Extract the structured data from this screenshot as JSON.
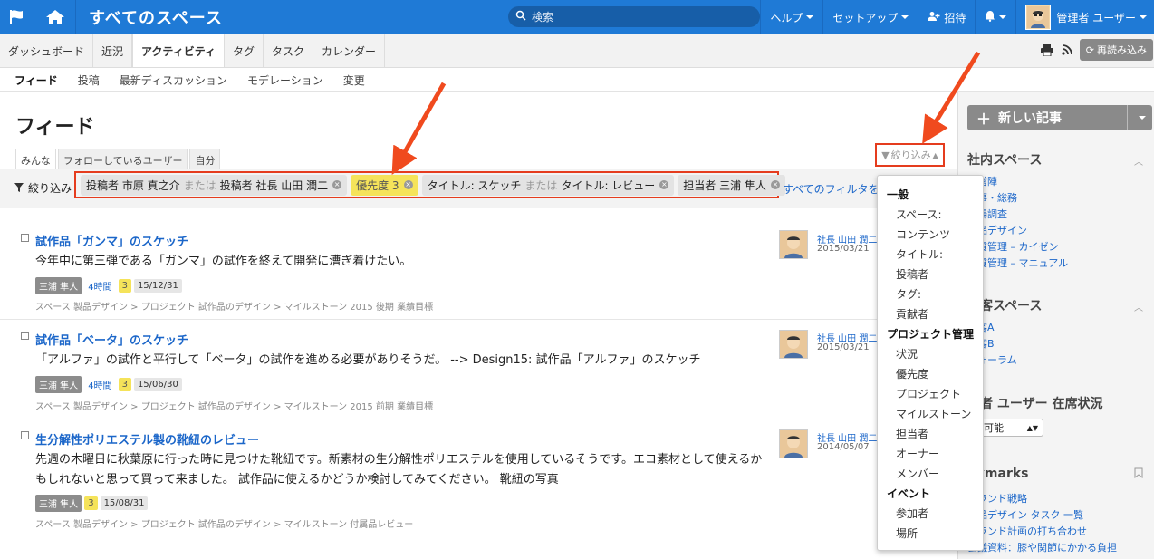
{
  "topbar": {
    "title": "すべてのスペース",
    "search_placeholder": "検索",
    "help": "ヘルプ",
    "setup": "セットアップ",
    "invite": "招待",
    "user": "管理者 ユーザー"
  },
  "tabs": [
    {
      "label": "ダッシュボード"
    },
    {
      "label": "近況"
    },
    {
      "label": "アクティビティ"
    },
    {
      "label": "タグ"
    },
    {
      "label": "タスク"
    },
    {
      "label": "カレンダー"
    }
  ],
  "reload_label": "再読み込み",
  "subnav": [
    {
      "label": "フィード"
    },
    {
      "label": "投稿"
    },
    {
      "label": "最新ディスカッション"
    },
    {
      "label": "モデレーション"
    },
    {
      "label": "変更"
    }
  ],
  "page": {
    "title": "フィード",
    "view_tabs": [
      "みんな",
      "フォローしているユーザー",
      "自分"
    ],
    "filter_button": "絞り込み"
  },
  "filterbar": {
    "label": "絞り込み",
    "chips": [
      {
        "part1": "投稿者 市原 真之介",
        "or": "または",
        "part2": "投稿者 社長 山田 潤二"
      },
      {
        "part1": "優先度 3",
        "or": "",
        "part2": ""
      },
      {
        "part1": "タイトル: スケッチ",
        "or": "または",
        "part2": "タイトル: レビュー"
      },
      {
        "part1": "担当者 三浦 隼人",
        "or": "",
        "part2": ""
      }
    ],
    "clear_all": "すべてのフィルタを"
  },
  "feed": [
    {
      "title": "試作品「ガンマ」のスケッチ",
      "body": "今年中に第三弾である「ガンマ」の試作を終えて開発に漕ぎ着けたい。",
      "assignee": "三浦 隼人",
      "hours": "4時間",
      "priority": "3",
      "due": "15/12/31",
      "path": "スペース 製品デザイン > プロジェクト 試作品のデザイン > マイルストーン 2015 後期 業績目標",
      "author": "社長 山田 潤二",
      "date": "2015/03/21"
    },
    {
      "title": "試作品「ベータ」のスケッチ",
      "body": "「アルファ」の試作と平行して「ベータ」の試作を進める必要がありそうだ。 --> Design15: 試作品「アルファ」のスケッチ",
      "assignee": "三浦 隼人",
      "hours": "4時間",
      "priority": "3",
      "due": "15/06/30",
      "path": "スペース 製品デザイン > プロジェクト 試作品のデザイン > マイルストーン 2015 前期 業績目標",
      "author": "社長 山田 潤二",
      "date": "2015/03/21"
    },
    {
      "title": "生分解性ポリエステル製の靴紐のレビュー",
      "body": "先週の木曜日に秋葉原に行った時に見つけた靴紐です。新素材の生分解性ポリエステルを使用しているそうです。エコ素材として使えるかもしれないと思って買って来ました。 試作品に使えるかどうか検討してみてください。 靴紐の写真",
      "assignee": "三浦 隼人",
      "hours": "",
      "priority": "3",
      "due": "15/08/31",
      "path": "スペース 製品デザイン > プロジェクト 試作品のデザイン > マイルストーン 付属品レビュー",
      "author": "社長 山田 潤二",
      "date": "2014/05/07"
    }
  ],
  "sidebar": {
    "new_post": "新しい記事",
    "internal_spaces_title": "社内スペース",
    "internal_spaces": [
      "経営陣",
      "人事・総務",
      "市場調査",
      "製品デザイン",
      "品質管理 – カイゼン",
      "品質管理 – マニュアル"
    ],
    "customer_spaces_title": "顧客スペース",
    "customer_spaces": [
      "顧客A",
      "顧客B",
      "フォーラム"
    ],
    "presence_title": "理者 ユーザー 在席状況",
    "presence_value": "絡可能",
    "bookmarks_title": "okmarks",
    "bookmarks": [
      "ブランド戦略",
      "製品デザイン タスク 一覧",
      "ブランド計画の打ち合わせ",
      "会議資料：膝や関節にかかる負担"
    ]
  },
  "dropdown": [
    {
      "group": "一般",
      "items": [
        "スペース:",
        "コンテンツ",
        "タイトル:",
        "投稿者",
        "タグ:",
        "貢献者"
      ]
    },
    {
      "group": "プロジェクト管理",
      "items": [
        "状況",
        "優先度",
        "プロジェクト",
        "マイルストーン",
        "担当者",
        "オーナー",
        "メンバー"
      ]
    },
    {
      "group": "イベント",
      "items": [
        "参加者",
        "場所"
      ]
    }
  ],
  "colors": {
    "topbar": "#1f7ad6",
    "link": "#1b66c9",
    "highlight": "#e53c1e",
    "priority_chip": "#f5e35a"
  }
}
